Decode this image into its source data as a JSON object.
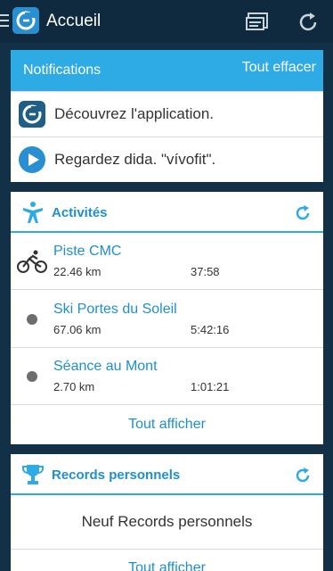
{
  "app_bar": {
    "title": "Accueil",
    "icons": {
      "menu": "hamburger-icon",
      "logo": "garmin-connect-logo-icon",
      "cards": "cards-view-icon",
      "sync": "sync-icon"
    }
  },
  "notifications": {
    "header": "Notifications",
    "clear_all": "Tout effacer",
    "items": [
      {
        "label": "Découvrez l'application.",
        "icon": "app-logo-icon"
      },
      {
        "label": "Regardez dida. \"vívofit\".",
        "icon": "play-video-icon"
      }
    ]
  },
  "activities": {
    "header": "Activités",
    "icon": "person-activity-icon",
    "refresh_icon": "refresh-icon",
    "items": [
      {
        "name": "Piste CMC",
        "distance": "22.46 km",
        "duration": "37:58",
        "icon": "cycling-icon"
      },
      {
        "name": "Ski Portes du Soleil",
        "distance": "67.06 km",
        "duration": "5:42:16",
        "icon": "dot-icon"
      },
      {
        "name": "Séance au Mont",
        "distance": "2.70 km",
        "duration": "1:01:21",
        "icon": "dot-icon"
      }
    ],
    "show_all": "Tout afficher"
  },
  "records": {
    "header": "Records personnels",
    "icon": "trophy-icon",
    "refresh_icon": "refresh-icon",
    "summary": "Neuf Records personnels",
    "show_all": "Tout afficher"
  },
  "colors": {
    "app_bar": "#0f2a3e",
    "background": "#123046",
    "accent": "#2eaae5",
    "link": "#1f8fd0",
    "dot": "#6d6d6d"
  }
}
